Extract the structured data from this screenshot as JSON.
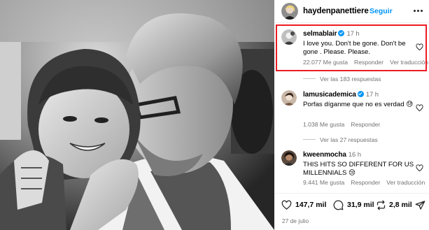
{
  "post": {
    "username": "haydenpanettiere",
    "follow_label": "Seguir",
    "date": "27 de julio"
  },
  "comments": [
    {
      "username": "selmablair",
      "time": "17 h",
      "text": "I love you. Don't be gone. Don't be gone . Please. Please.",
      "likes": "22.077 Me gusta",
      "reply_label": "Responder",
      "translate_label": "Ver traducción",
      "view_replies": "Ver las 183 respuestas"
    },
    {
      "username": "lamusicademica",
      "time": "17 h",
      "text": "Porfas díganme que no es verdad 😓",
      "likes": "1.038 Me gusta",
      "reply_label": "Responder",
      "view_replies": "Ver las 27 respuestas"
    },
    {
      "username": "kweenmocha",
      "time": "16 h",
      "text": "THIS HITS SO DIFFERENT FOR US MILLENNIALS 😢",
      "likes": "9.441 Me gusta",
      "reply_label": "Responder",
      "translate_label": "Ver traducción"
    }
  ],
  "actions": {
    "likes": "147,7 mil",
    "comments": "31,9 mil",
    "reposts": "2,8 mil"
  },
  "colors": {
    "accent": "#0095f6",
    "highlight": "#ed1c24",
    "muted": "#737373"
  }
}
